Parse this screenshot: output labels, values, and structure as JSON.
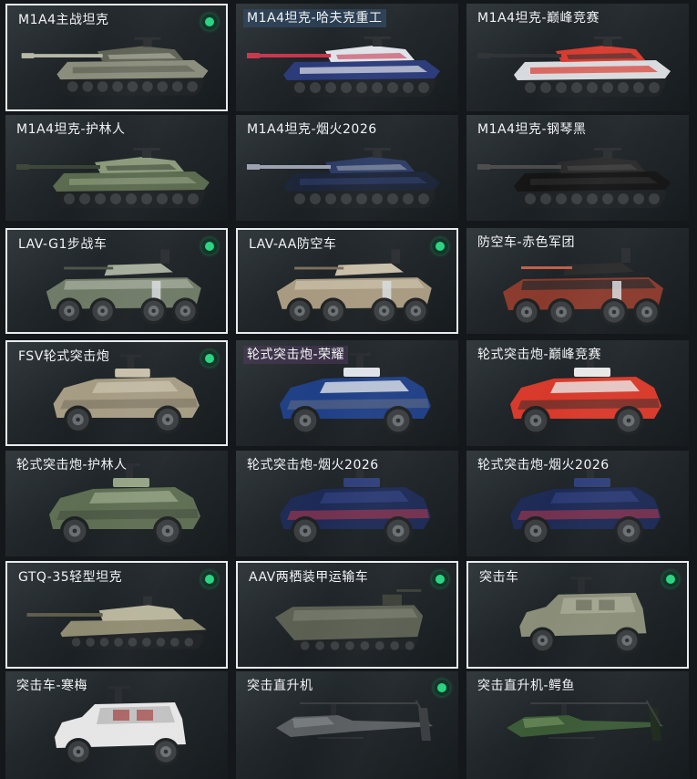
{
  "vehicles": [
    {
      "name": "M1A4主战坦克",
      "type": "tank",
      "owned": true,
      "selected": true,
      "colors": [
        "#8a8d7b",
        "#5f6355",
        "#b5b7a6"
      ]
    },
    {
      "name": "M1A4坦克-哈夫克重工",
      "type": "tank",
      "owned": false,
      "selected": false,
      "label_style": "hl-blue",
      "colors": [
        "#2a3a7a",
        "#dfe3ea",
        "#c8344a"
      ]
    },
    {
      "name": "M1A4坦克-巅峰竞赛",
      "type": "tank",
      "owned": false,
      "selected": false,
      "colors": [
        "#d8dbde",
        "#d83a2e",
        "#2d3033"
      ]
    },
    {
      "name": "M1A4坦克-护林人",
      "type": "tank",
      "owned": false,
      "selected": false,
      "colors": [
        "#5a6a4e",
        "#8b9a7a",
        "#3a4436"
      ]
    },
    {
      "name": "M1A4坦克-烟火2026",
      "type": "tank",
      "owned": false,
      "selected": false,
      "colors": [
        "#1c2438",
        "#2c3c66",
        "#9aa0b0"
      ]
    },
    {
      "name": "M1A4坦克-钢琴黑",
      "type": "tank",
      "owned": false,
      "selected": false,
      "colors": [
        "#141414",
        "#2a2a2a",
        "#4a4a4a"
      ]
    },
    {
      "name": "LAV-G1步战车",
      "type": "apc",
      "owned": true,
      "selected": true,
      "colors": [
        "#6e7a66",
        "#a5ad9c",
        "#4c5548"
      ]
    },
    {
      "name": "LAV-AA防空车",
      "type": "apc",
      "owned": true,
      "selected": true,
      "colors": [
        "#a89a80",
        "#c9bfa8",
        "#7c705d"
      ]
    },
    {
      "name": "防空车-赤色军团",
      "type": "apc",
      "owned": false,
      "selected": false,
      "colors": [
        "#8a3a2c",
        "#2a2a2a",
        "#c06048"
      ]
    },
    {
      "name": "FSV轮式突击炮",
      "type": "armored",
      "owned": true,
      "selected": true,
      "colors": [
        "#a69c84",
        "#c8c0aa",
        "#6f6858"
      ]
    },
    {
      "name": "轮式突击炮-荣耀",
      "type": "armored",
      "owned": false,
      "selected": false,
      "label_style": "hl-purple",
      "colors": [
        "#1f3f86",
        "#dfe3ea",
        "#6a7180"
      ]
    },
    {
      "name": "轮式突击炮-巅峰竞赛",
      "type": "armored",
      "owned": false,
      "selected": false,
      "colors": [
        "#d8392a",
        "#e8e8e8",
        "#2a2a2a"
      ]
    },
    {
      "name": "轮式突击炮-护林人",
      "type": "armored",
      "owned": false,
      "selected": false,
      "colors": [
        "#5e6e52",
        "#95a484",
        "#3c463a"
      ]
    },
    {
      "name": "轮式突击炮-烟火2026",
      "type": "armored",
      "owned": false,
      "selected": false,
      "colors": [
        "#1c2a55",
        "#2f3f7a",
        "#c8384a"
      ]
    },
    {
      "name": "轮式突击炮-烟火2026",
      "type": "armored",
      "owned": false,
      "selected": false,
      "colors": [
        "#1c2a55",
        "#2f3f7a",
        "#c8384a"
      ]
    },
    {
      "name": "GTQ-35轻型坦克",
      "type": "lighttank",
      "owned": true,
      "selected": true,
      "colors": [
        "#8f8c72",
        "#b8b59c",
        "#5e5c4a"
      ]
    },
    {
      "name": "AAV两栖装甲运输车",
      "type": "amphib",
      "owned": true,
      "selected": true,
      "colors": [
        "#5a5f52",
        "#7a7f70",
        "#3b3f36"
      ]
    },
    {
      "name": "突击车",
      "type": "mrap",
      "owned": true,
      "selected": true,
      "colors": [
        "#8a8e78",
        "#a8ac96",
        "#5c604f"
      ]
    },
    {
      "name": "突击车-寒梅",
      "type": "mrap",
      "owned": false,
      "selected": false,
      "colors": [
        "#e6e6e6",
        "#b8b8b8",
        "#a02a2a"
      ]
    },
    {
      "name": "突击直升机",
      "type": "heli",
      "owned": true,
      "selected": false,
      "colors": [
        "#5a5e60",
        "#7d8284",
        "#3a3d3f"
      ]
    },
    {
      "name": "突击直升机-鳄鱼",
      "type": "heli",
      "owned": false,
      "selected": false,
      "colors": [
        "#3b5a36",
        "#6a8a5a",
        "#1e2a1c"
      ]
    }
  ]
}
